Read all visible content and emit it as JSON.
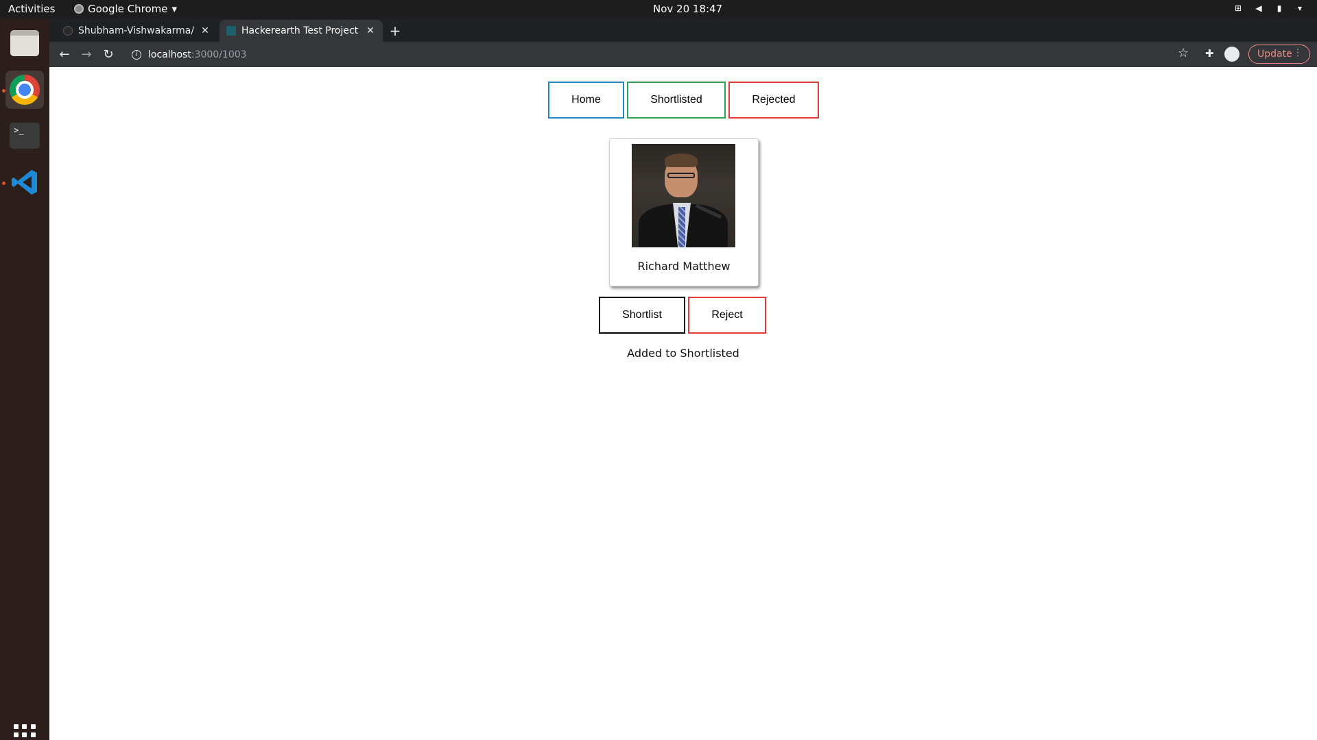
{
  "system": {
    "activities": "Activities",
    "app_name": "Google Chrome",
    "clock": "Nov 20  18:47"
  },
  "browser": {
    "tabs": [
      {
        "title": "Shubham-Vishwakarma/F",
        "active": false
      },
      {
        "title": "Hackerearth Test Project",
        "active": true
      }
    ],
    "url_host": "localhost",
    "url_path": ":3000/1003",
    "update_label": "Update"
  },
  "page": {
    "nav": {
      "home": "Home",
      "shortlisted": "Shortlisted",
      "rejected": "Rejected"
    },
    "candidate": {
      "name": "Richard Matthew"
    },
    "actions": {
      "shortlist": "Shortlist",
      "reject": "Reject"
    },
    "status_message": "Added to Shortlisted"
  },
  "colors": {
    "home_border": "#1e88c8",
    "shortlisted_border": "#2ea44f",
    "rejected_border": "#e53935",
    "shortlist_border": "#000000",
    "reject_border": "#e53935"
  }
}
